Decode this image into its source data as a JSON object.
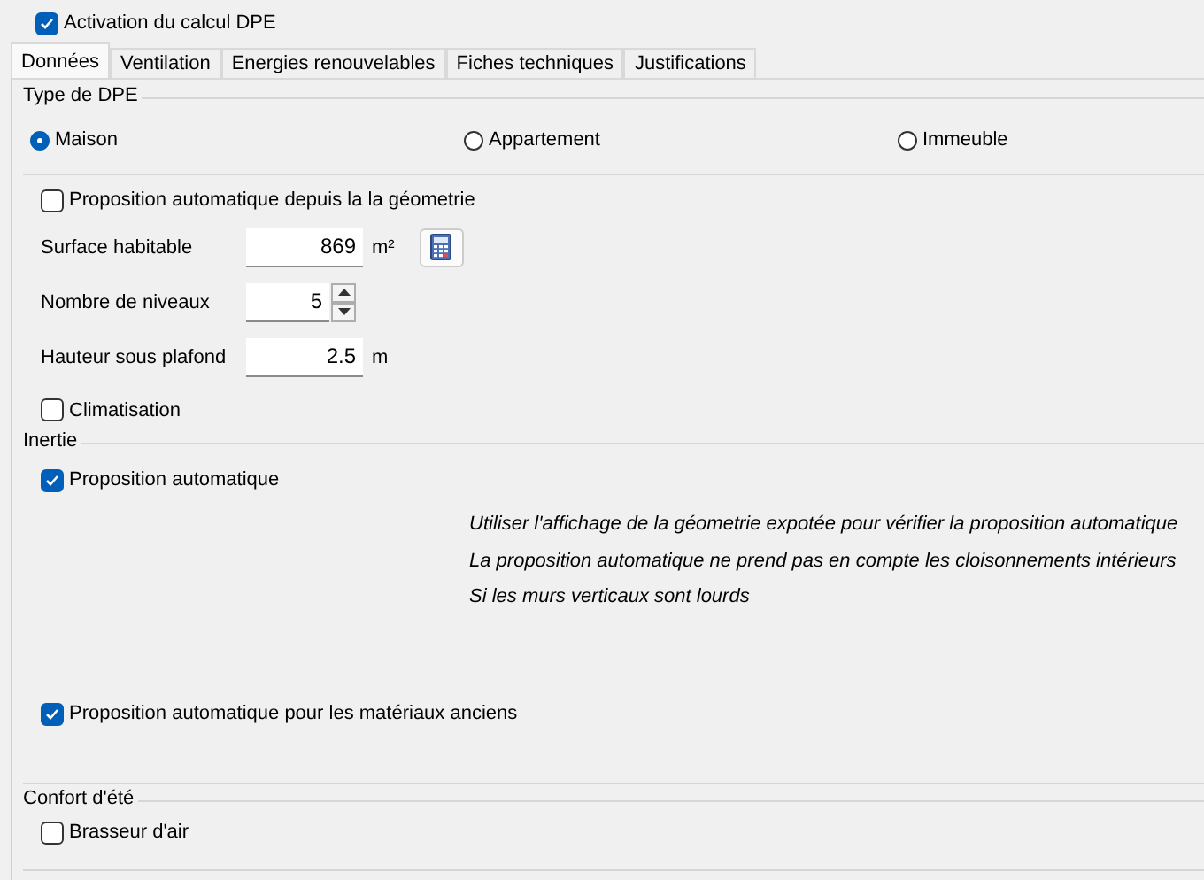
{
  "activation": {
    "label": "Activation du calcul DPE",
    "checked": true
  },
  "tabs": [
    {
      "label": "Données",
      "selected": true
    },
    {
      "label": "Ventilation",
      "selected": false
    },
    {
      "label": "Energies renouvelables",
      "selected": false
    },
    {
      "label": "Fiches techniques",
      "selected": false
    },
    {
      "label": "Justifications",
      "selected": false
    }
  ],
  "type_dpe": {
    "title": "Type de DPE",
    "options": [
      {
        "label": "Maison",
        "selected": true
      },
      {
        "label": "Appartement",
        "selected": false
      },
      {
        "label": "Immeuble",
        "selected": false
      }
    ]
  },
  "auto_geometry": {
    "label": "Proposition automatique depuis la la géometrie",
    "checked": false
  },
  "fields": [
    {
      "kind": "calc",
      "label": "Surface habitable",
      "value": "869",
      "unit": "m²"
    },
    {
      "kind": "spin",
      "label": "Nombre de niveaux",
      "value": "5"
    },
    {
      "kind": "unit",
      "label": "Hauteur sous plafond",
      "value": "2.5",
      "unit": "m"
    }
  ],
  "climatisation": {
    "label": "Climatisation",
    "checked": false
  },
  "inertie": {
    "title": "Inertie",
    "auto": {
      "label": "Proposition automatique",
      "checked": true
    },
    "notes": [
      "Utiliser l'affichage de la géometrie expotée pour vérifier la proposition automatique",
      " La proposition automatique ne prend pas en compte les cloisonnements intérieurs",
      "Si les murs verticaux sont lourds"
    ],
    "old_materials": {
      "label": "Proposition automatique pour les matériaux anciens",
      "checked": true
    }
  },
  "confort": {
    "title": "Confort d'été",
    "brasseur": {
      "label": "Brasseur d'air",
      "checked": false
    }
  }
}
